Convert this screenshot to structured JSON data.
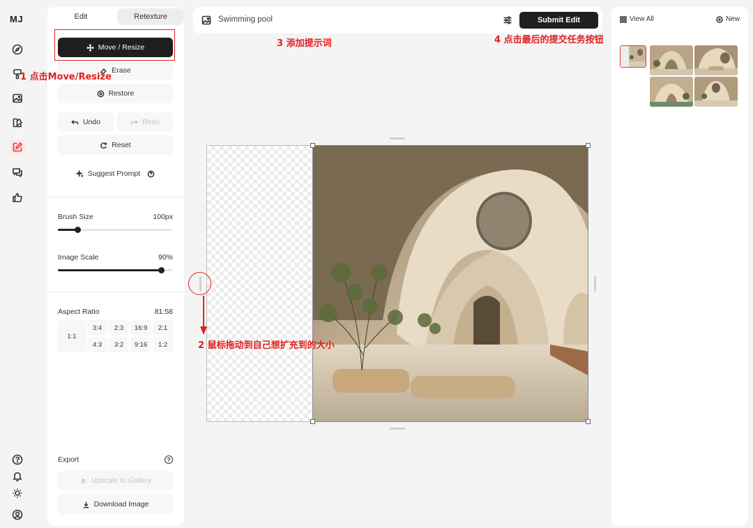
{
  "rail": {
    "logo": "MJ",
    "icons": [
      "compass-icon",
      "brush-icon",
      "image-icon",
      "palette-icon",
      "edit-icon",
      "chat-icon",
      "thumbs-up-icon",
      "help-icon",
      "bell-icon",
      "sun-icon",
      "user-icon"
    ],
    "active": "edit-icon"
  },
  "panel": {
    "tabs": [
      "Edit",
      "Retexture"
    ],
    "move_resize": "Move / Resize",
    "erase": "Erase",
    "restore": "Restore",
    "undo": "Undo",
    "redo": "Redo",
    "reset": "Reset",
    "suggest_prompt": "Suggest Prompt",
    "brush_size_label": "Brush Size",
    "brush_size_value": "100px",
    "brush_size_fraction": 0.17,
    "image_scale_label": "Image Scale",
    "image_scale_value": "90%",
    "image_scale_fraction": 0.9,
    "aspect_ratio_label": "Aspect Ratio",
    "aspect_ratio_value": "81:58",
    "aspect_square": "1:1",
    "aspect_top": [
      "3:4",
      "2:3",
      "16:9",
      "2:1"
    ],
    "aspect_bottom": [
      "4:3",
      "3:2",
      "9:16",
      "1:2"
    ],
    "export_label": "Export",
    "upscale": "Upscale to Gallery",
    "download": "Download Image"
  },
  "topbar": {
    "prompt": "Swimming pool",
    "submit": "Submit Edit"
  },
  "rightpanel": {
    "view_all": "View All",
    "new": "New"
  },
  "annotations": {
    "step1": "1 点击Move/Resize",
    "step2": "2 鼠标拖动到自己想扩充到的大小",
    "step3": "3 添加提示词",
    "step4": "4 点击最后的提交任务按钮"
  },
  "colors": {
    "accent_red": "#e02020",
    "dark_button": "#1f1f21"
  }
}
